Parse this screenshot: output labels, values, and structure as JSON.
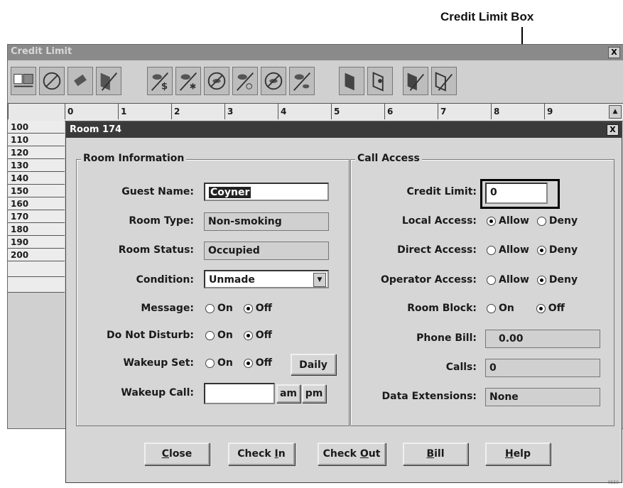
{
  "callout": {
    "label": "Credit Limit Box"
  },
  "outer_window": {
    "title": "Credit Limit",
    "close": "X",
    "ruler_labels": [
      "0",
      "1",
      "2",
      "3",
      "4",
      "5",
      "6",
      "7",
      "8",
      "9"
    ],
    "ruler_scroll": "▲",
    "rooms": [
      "100",
      "110",
      "120",
      "130",
      "140",
      "150",
      "160",
      "170",
      "180",
      "190",
      "200",
      "",
      ""
    ]
  },
  "dialog": {
    "title": "Room 174",
    "close": "X",
    "room_info": {
      "group_label": "Room Information",
      "guest_name_label": "Guest Name:",
      "guest_name_value": "Coyner",
      "room_type_label": "Room Type:",
      "room_type_value": "Non-smoking",
      "room_status_label": "Room Status:",
      "room_status_value": "Occupied",
      "condition_label": "Condition:",
      "condition_value": "Unmade",
      "message_label": "Message:",
      "dnd_label": "Do Not Disturb:",
      "wakeup_set_label": "Wakeup Set:",
      "daily_button": "Daily",
      "wakeup_call_label": "Wakeup Call:",
      "wakeup_call_value": "",
      "am_label": "am",
      "pm_label": "pm",
      "on_label": "On",
      "off_label": "Off"
    },
    "call_access": {
      "group_label": "Call Access",
      "credit_limit_label": "Credit Limit:",
      "credit_limit_value": "0",
      "local_access_label": "Local Access:",
      "direct_access_label": "Direct Access:",
      "operator_access_label": "Operator Access:",
      "room_block_label": "Room Block:",
      "allow_label": "Allow",
      "deny_label": "Deny",
      "on_label": "On",
      "off_label": "Off",
      "phone_bill_label": "Phone Bill:",
      "phone_bill_value": "0.00",
      "calls_label": "Calls:",
      "calls_value": "0",
      "data_ext_label": "Data Extensions:",
      "data_ext_value": "None"
    },
    "buttons": {
      "close": {
        "pre": "",
        "key": "C",
        "post": "lose"
      },
      "check_in": {
        "pre": "Check ",
        "key": "I",
        "post": "n"
      },
      "check_out": {
        "pre": "Check ",
        "key": "O",
        "post": "ut"
      },
      "bill": {
        "pre": "",
        "key": "B",
        "post": "ill"
      },
      "help": {
        "pre": "",
        "key": "H",
        "post": "elp"
      }
    }
  },
  "corner_mark": "0550"
}
